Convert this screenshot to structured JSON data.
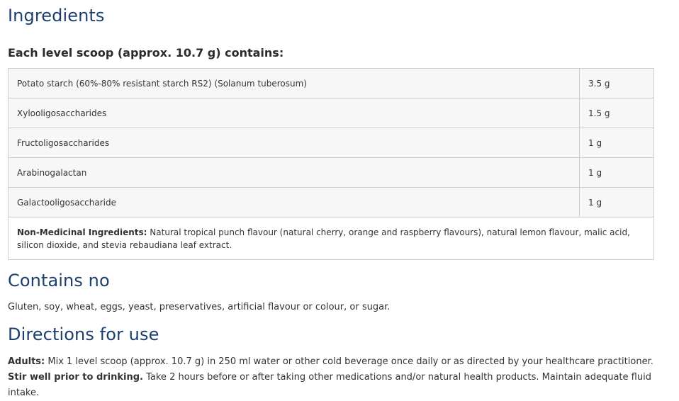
{
  "ingredients": {
    "title": "Ingredients",
    "scoop_heading": "Each level scoop (approx. 10.7 g) contains:",
    "rows": [
      {
        "name": "Potato starch (60%-80% resistant starch RS2) (Solanum tuberosum)",
        "amount": "3.5 g"
      },
      {
        "name": "Xylooligosaccharides",
        "amount": "1.5 g"
      },
      {
        "name": "Fructoligosaccharides",
        "amount": "1 g"
      },
      {
        "name": "Arabinogalactan",
        "amount": "1 g"
      },
      {
        "name": "Galactooligosaccharide",
        "amount": "1 g"
      }
    ],
    "non_medicinal": {
      "label": "Non-Medicinal Ingredients:",
      "text": " Natural tropical punch flavour (natural cherry, orange and raspberry flavours), natural lemon flavour, malic acid, silicon dioxide, and stevia rebaudiana leaf extract."
    }
  },
  "contains_no": {
    "title": "Contains no",
    "text": "Gluten, soy, wheat, eggs, yeast, preservatives, artificial flavour or colour, or sugar."
  },
  "directions": {
    "title": "Directions for use",
    "adults_label": "Adults:",
    "text_1": " Mix 1 level scoop (approx. 10.7 g) in 250 ml water or other cold beverage once daily or as directed by your healthcare practitioner. ",
    "stir_label": "Stir well prior to drinking.",
    "text_2": " Take 2 hours before or after taking other medications and/or natural health products. Maintain adequate fluid intake."
  }
}
